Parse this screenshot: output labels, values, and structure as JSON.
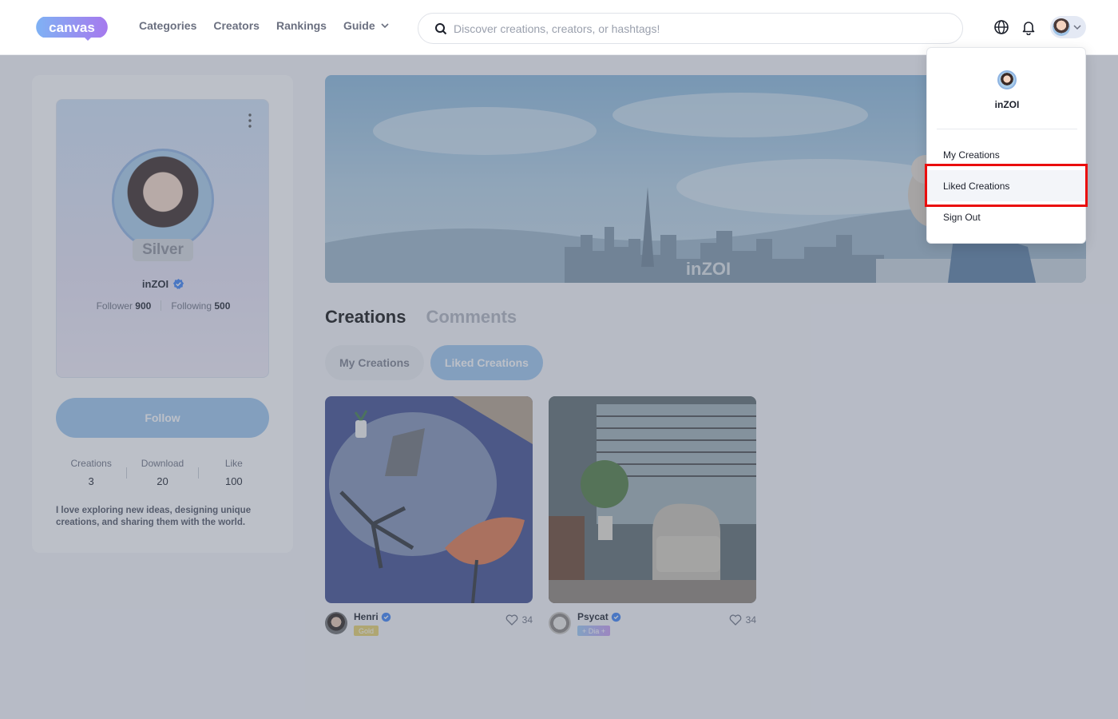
{
  "header": {
    "logo_text": "canvas",
    "nav": [
      {
        "label": "Categories"
      },
      {
        "label": "Creators"
      },
      {
        "label": "Rankings"
      },
      {
        "label": "Guide"
      }
    ],
    "search_placeholder": "Discover creations, creators, or hashtags!",
    "icons": [
      "globe-icon",
      "bell-icon",
      "avatar",
      "chevron-down-icon"
    ]
  },
  "profile": {
    "tier": "Silver",
    "name": "inZOI",
    "follower_label": "Follower",
    "follower_count": "900",
    "following_label": "Following",
    "following_count": "500",
    "follow_button": "Follow",
    "stats": [
      {
        "label": "Creations",
        "value": "3"
      },
      {
        "label": "Download",
        "value": "20"
      },
      {
        "label": "Like",
        "value": "100"
      }
    ],
    "bio": "I love exploring new ideas, designing unique creations, and sharing them with the world."
  },
  "banner": {
    "watermark": "inZOI"
  },
  "content": {
    "tabs": [
      {
        "label": "Creations"
      },
      {
        "label": "Comments"
      }
    ],
    "filters": [
      {
        "label": "My Creations"
      },
      {
        "label": "Liked Creations"
      }
    ],
    "cards": [
      {
        "author": "Henri",
        "badge": "Gold",
        "badge_color": "#e9d36b",
        "likes": "34"
      },
      {
        "author": "Psycat",
        "badge": "+ Dia +",
        "badge_color": "#b9a5f0",
        "likes": "34"
      }
    ]
  },
  "dropdown": {
    "name": "inZOI",
    "items": [
      {
        "label": "My Creations"
      },
      {
        "label": "Liked Creations"
      },
      {
        "label": "Sign Out"
      }
    ]
  },
  "colors": {
    "accent": "#9ec6ee",
    "highlight": "#ea0d0d",
    "brand": "#8b7bf0"
  }
}
